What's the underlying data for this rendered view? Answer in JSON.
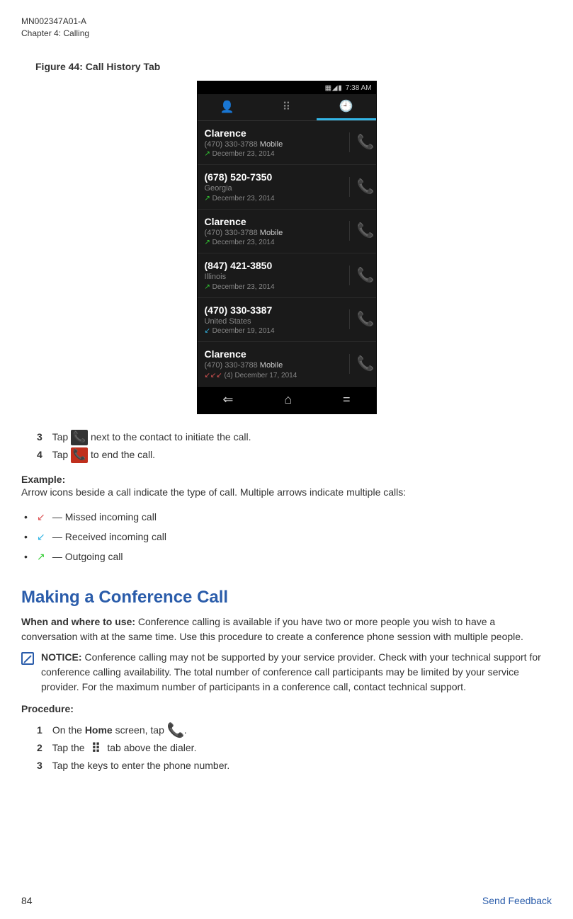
{
  "header": {
    "doc_id": "MN002347A01-A",
    "chapter": "Chapter 4:  Calling"
  },
  "figure_title": "Figure 44: Call History Tab",
  "screenshot": {
    "status_time": "7:38 AM",
    "tabs": {
      "t1": "👤",
      "t2": "⠿",
      "t3": "🕘"
    },
    "calls": [
      {
        "name": "Clarence",
        "sub": "(470) 330-3788",
        "sub2": "Mobile",
        "date": "December 23, 2014",
        "arrow": "↗",
        "arrowClass": "arrow-out"
      },
      {
        "name": "(678) 520-7350",
        "sub": "Georgia",
        "sub2": "",
        "date": "December 23, 2014",
        "arrow": "↗",
        "arrowClass": "arrow-out"
      },
      {
        "name": "Clarence",
        "sub": "(470) 330-3788",
        "sub2": "Mobile",
        "date": "December 23, 2014",
        "arrow": "↗",
        "arrowClass": "arrow-out"
      },
      {
        "name": "(847) 421-3850",
        "sub": "Illinois",
        "sub2": "",
        "date": "December 23, 2014",
        "arrow": "↗",
        "arrowClass": "arrow-out"
      },
      {
        "name": "(470) 330-3387",
        "sub": "United States",
        "sub2": "",
        "date": "December 19, 2014",
        "arrow": "↙",
        "arrowClass": "arrow-in"
      },
      {
        "name": "Clarence",
        "sub": "(470) 330-3788",
        "sub2": "Mobile",
        "date": "(4) December 17, 2014",
        "arrow": "↙↙↙",
        "arrowClass": "arrow-miss"
      }
    ],
    "nav": {
      "back": "⇐",
      "home": "⌂",
      "recent": "="
    }
  },
  "steps_a": {
    "s3": {
      "num": "3",
      "pre": "Tap ",
      "post": " next to the contact to initiate the call."
    },
    "s4": {
      "num": "4",
      "pre": "Tap ",
      "post": " to end the call."
    }
  },
  "example": {
    "heading": "Example:",
    "text": "Arrow icons beside a call indicate the type of call. Multiple arrows indicate multiple calls:",
    "b1": " — Missed incoming call",
    "b2": " — Received incoming call",
    "b3": " — Outgoing call"
  },
  "section": {
    "title": "Making a Conference Call",
    "when_label": "When and where to use:",
    "when_text": " Conference calling is available if you have two or more people you wish to have a conversation with at the same time. Use this procedure to create a conference phone session with multiple people.",
    "notice_label": "NOTICE:",
    "notice_text": " Conference calling may not be supported by your service provider. Check with your technical support for conference calling availability. The total number of conference call participants may be limited by your service provider. For the maximum number of participants in a conference call, contact technical support.",
    "procedure": "Procedure:",
    "p1": {
      "num": "1",
      "pre": "On the ",
      "bold": "Home",
      "mid": " screen, tap ",
      "post": "."
    },
    "p2": {
      "num": "2",
      "pre": "Tap the ",
      "post": " tab above the dialer."
    },
    "p3": {
      "num": "3",
      "text": "Tap the keys to enter the phone number."
    }
  },
  "footer": {
    "pagenum": "84",
    "feedback": "Send Feedback"
  }
}
